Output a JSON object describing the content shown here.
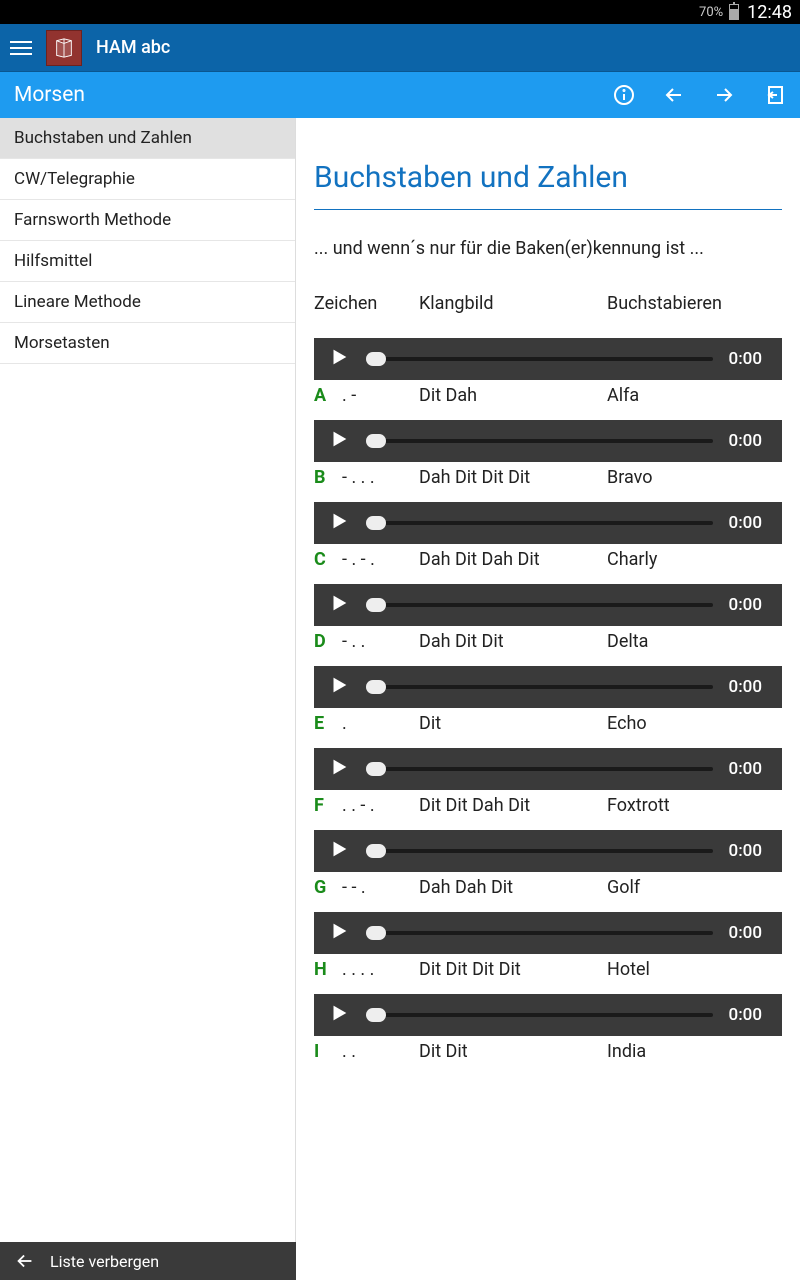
{
  "status": {
    "battery": "70%",
    "time": "12:48"
  },
  "appbar": {
    "title": "HAM abc"
  },
  "section": {
    "title": "Morsen"
  },
  "sidebar": {
    "items": [
      "Buchstaben und Zahlen",
      "CW/Telegraphie",
      "Farnsworth Methode",
      "Hilfsmittel",
      "Lineare Methode",
      "Morsetasten"
    ],
    "active_index": 0
  },
  "bottombar": {
    "label": "Liste verbergen"
  },
  "content": {
    "title": "Buchstaben und Zahlen",
    "intro": "... und wenn´s nur für die Baken(er)kennung ist ...",
    "columns": {
      "zeichen": "Zeichen",
      "klangbild": "Klangbild",
      "buchstabieren": "Buchstabieren"
    },
    "player_time": "0:00",
    "entries": [
      {
        "letter": "A",
        "morse": ". -",
        "klang": "Dit Dah",
        "spell": "Alfa"
      },
      {
        "letter": "B",
        "morse": "- . . .",
        "klang": "Dah Dit Dit Dit",
        "spell": "Bravo"
      },
      {
        "letter": "C",
        "morse": "- . - .",
        "klang": "Dah Dit Dah Dit",
        "spell": "Charly"
      },
      {
        "letter": "D",
        "morse": "- . .",
        "klang": "Dah Dit Dit",
        "spell": "Delta"
      },
      {
        "letter": "E",
        "morse": ".",
        "klang": "Dit",
        "spell": "Echo"
      },
      {
        "letter": "F",
        "morse": ". . - .",
        "klang": "Dit Dit Dah Dit",
        "spell": "Foxtrott"
      },
      {
        "letter": "G",
        "morse": "- - .",
        "klang": "Dah Dah Dit",
        "spell": "Golf"
      },
      {
        "letter": "H",
        "morse": ". . . .",
        "klang": "Dit Dit Dit Dit",
        "spell": "Hotel"
      },
      {
        "letter": "I",
        "morse": ". .",
        "klang": "Dit Dit",
        "spell": "India"
      }
    ]
  }
}
